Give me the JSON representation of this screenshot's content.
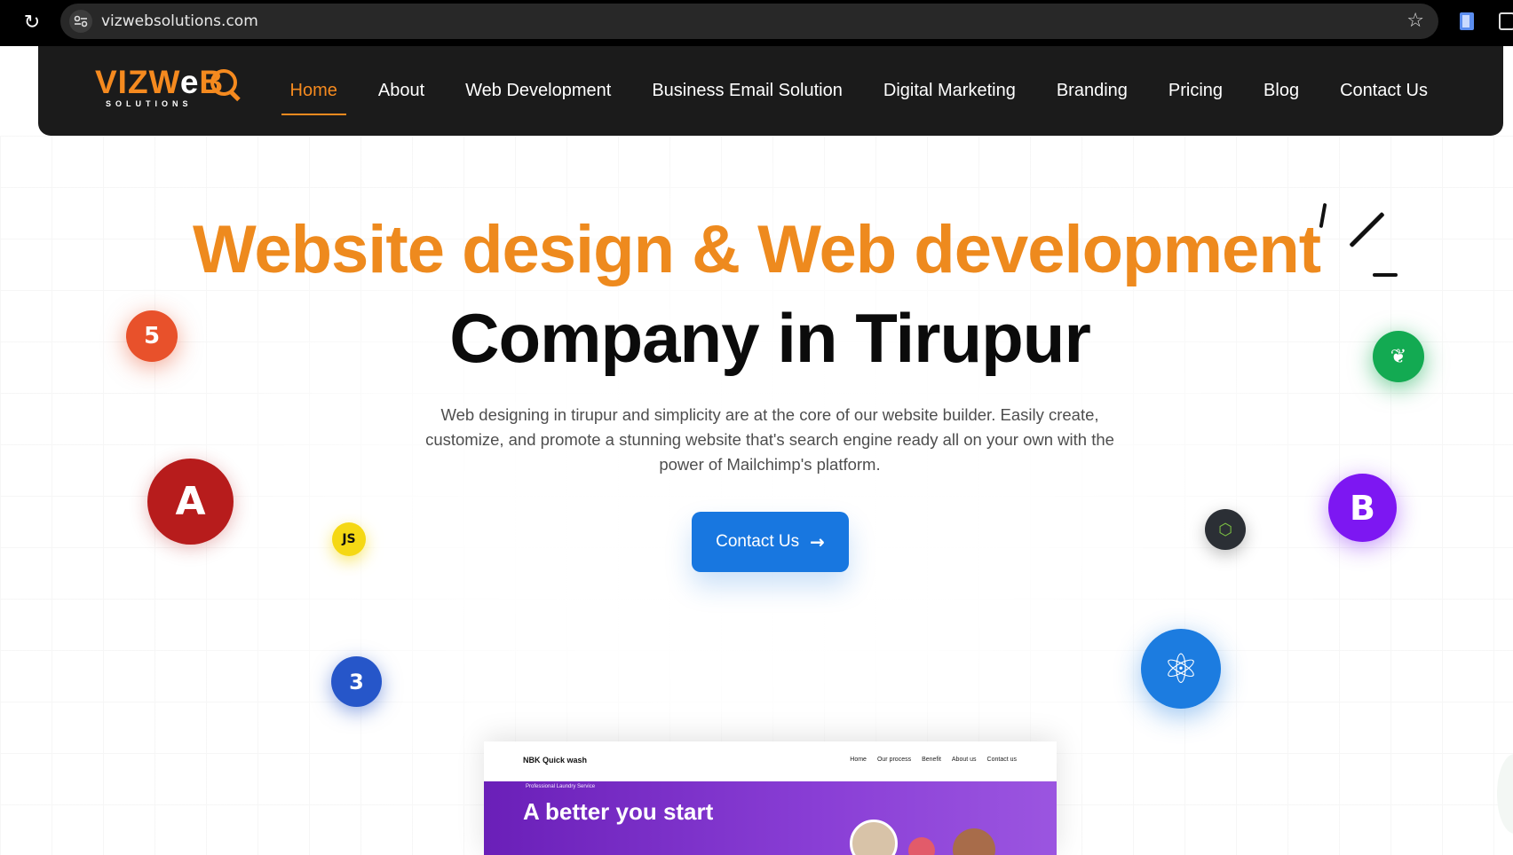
{
  "browser": {
    "url": "vizwebsolutions.com",
    "reload_icon": "reload-icon",
    "star_icon": "star-icon"
  },
  "logo": {
    "main_orange": "VIZW",
    "main_e": "e",
    "main_b": "B",
    "sub": "SOLUTIONS"
  },
  "nav": {
    "items": [
      {
        "label": "Home",
        "active": true
      },
      {
        "label": "About"
      },
      {
        "label": "Web Development"
      },
      {
        "label": "Business Email Solution"
      },
      {
        "label": "Digital Marketing"
      },
      {
        "label": "Branding"
      },
      {
        "label": "Pricing"
      },
      {
        "label": "Blog"
      },
      {
        "label": "Contact Us"
      }
    ]
  },
  "hero": {
    "headline_line1": "Website design & Web development",
    "headline_line2": "Company in Tirupur",
    "subtext": "Web designing in tirupur and simplicity are at the core of our website builder. Easily create, customize, and promote a stunning website that's search engine ready all on your own with the power of Mailchimp's platform.",
    "cta_label": "Contact Us",
    "accent_color": "#ee8a1e",
    "cta_color": "#1877e0"
  },
  "tech_icons": {
    "html5": "5",
    "angular": "A",
    "js": "JS",
    "css3": "3",
    "mongodb": "❦",
    "nodejs": "⬡",
    "bootstrap": "B",
    "react": "⚛"
  },
  "preview": {
    "brand": "NBK Quick wash",
    "links": [
      "Home",
      "Our process",
      "Benefit",
      "About us",
      "Contact us"
    ],
    "tag": "Professional Laundry Service",
    "title": "A better you start"
  }
}
